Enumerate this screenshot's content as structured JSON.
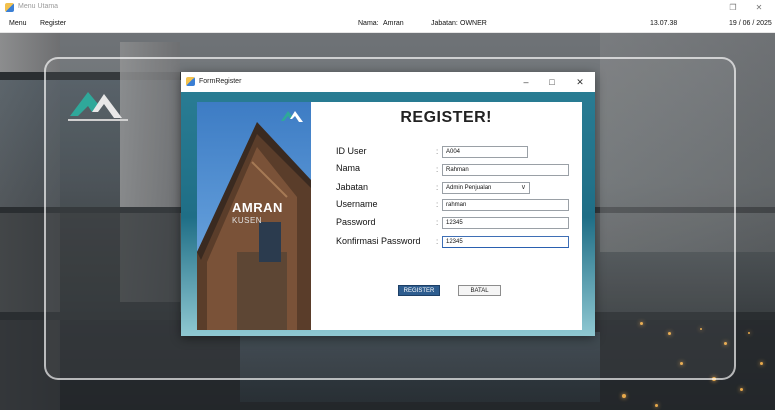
{
  "window": {
    "title": "Menu Utama",
    "icon": "app-form-icon",
    "controls": [
      "restore-icon",
      "close-icon"
    ]
  },
  "menubar": {
    "items": [
      "Menu",
      "Register"
    ]
  },
  "session": {
    "nama_label": "Nama:",
    "nama_value": "Amran",
    "jabatan_label": "Jabatan:",
    "jabatan_value": "OWNER",
    "time": "13.07.38",
    "date": "19 / 06 / 2025"
  },
  "dialog": {
    "title": "FormRegister",
    "heading": "REGISTER!",
    "brand": {
      "name": "AMRAN",
      "sub": "KUSEN"
    },
    "fields": {
      "id_user": {
        "label": "ID User",
        "value": "A004"
      },
      "nama": {
        "label": "Nama",
        "value": "Rahman"
      },
      "jabatan": {
        "label": "Jabatan",
        "value": "Admin Penjualan"
      },
      "username": {
        "label": "Username",
        "value": "rahman"
      },
      "password": {
        "label": "Password",
        "value": "12345"
      },
      "konfirmasi": {
        "label": "Konfirmasi Password",
        "value": "12345"
      }
    },
    "colon": ":",
    "buttons": {
      "register": "REGISTER",
      "batal": "BATAL"
    }
  },
  "colors": {
    "accent": "#2e5d8f",
    "dialog_bg": "#2a7e95",
    "brand_teal": "#2fa89a"
  }
}
